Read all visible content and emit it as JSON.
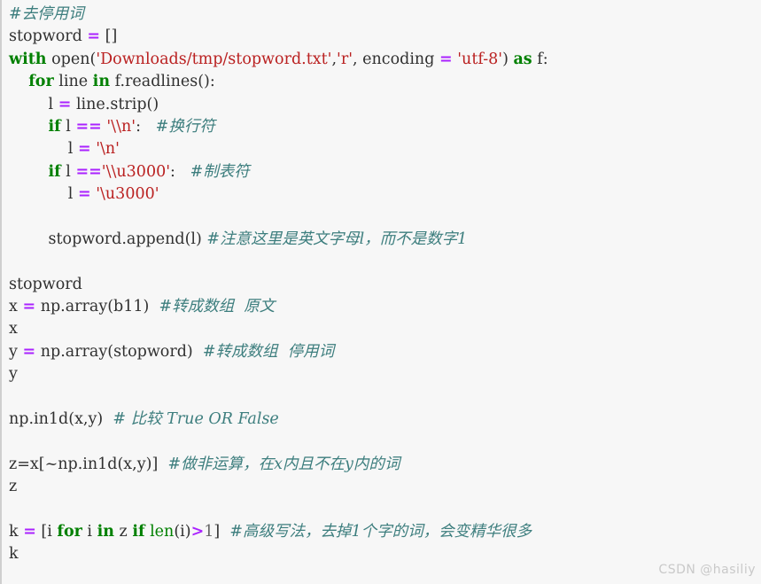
{
  "cell": {
    "type": "jupyter-code-cell",
    "language": "python",
    "background_color": "#f7f7f7",
    "left_border_color": "#cfcfcf",
    "syntax_colors": {
      "keyword": "#008000",
      "builtin": "#008000",
      "string": "#BA2121",
      "operator": "#AA22FF",
      "comment": "#3D7E7E",
      "plain": "#303030"
    }
  },
  "lines": [
    {
      "i": 0,
      "text": "#去停用词"
    },
    {
      "i": 1,
      "text": "stopword = []"
    },
    {
      "i": 2,
      "text": "with open('Downloads/tmp/stopword.txt','r', encoding = 'utf-8') as f:"
    },
    {
      "i": 3,
      "text": "    for line in f.readlines():"
    },
    {
      "i": 4,
      "text": "        l = line.strip()"
    },
    {
      "i": 5,
      "text": "        if l == '\\\\n':   #换行符"
    },
    {
      "i": 6,
      "text": "            l = '\\n'"
    },
    {
      "i": 7,
      "text": "        if l =='\\\\u3000':   #制表符"
    },
    {
      "i": 8,
      "text": "            l = '\\u3000'"
    },
    {
      "i": 9,
      "text": ""
    },
    {
      "i": 10,
      "text": "        stopword.append(l) #注意这里是英文字母l,而不是数字1"
    },
    {
      "i": 11,
      "text": ""
    },
    {
      "i": 12,
      "text": "stopword"
    },
    {
      "i": 13,
      "text": "x = np.array(b11)  #转成数组  原文"
    },
    {
      "i": 14,
      "text": "x"
    },
    {
      "i": 15,
      "text": "y = np.array(stopword)  #转成数组  停用词"
    },
    {
      "i": 16,
      "text": "y"
    },
    {
      "i": 17,
      "text": ""
    },
    {
      "i": 18,
      "text": "np.in1d(x,y)  # 比较 True OR False"
    },
    {
      "i": 19,
      "text": ""
    },
    {
      "i": 20,
      "text": "z=x[~np.in1d(x,y)]  #做非运算，在x内且不在y内的词"
    },
    {
      "i": 21,
      "text": "z"
    },
    {
      "i": 22,
      "text": ""
    },
    {
      "i": 23,
      "text": "k = [i for i in z if len(i)>1]  #高级写法，去掉1个字的词，会变精华很多"
    },
    {
      "i": 24,
      "text": "k"
    }
  ],
  "tokens": {
    "comment_remove_stopwords": "#去停用词",
    "var_stopword": "stopword",
    "op_assign": "=",
    "empty_list": "[]",
    "kw_with": "with",
    "fn_open": "open",
    "str_path": "'Downloads/tmp/stopword.txt'",
    "str_mode": "'r'",
    "arg_encoding": "encoding",
    "str_utf8": "'utf-8'",
    "kw_as": "as",
    "var_f": "f",
    "kw_for": "for",
    "var_line": "line",
    "kw_in": "in",
    "fn_readlines": "f.readlines()",
    "var_l": "l",
    "fn_strip": "line.strip()",
    "kw_if": "if",
    "op_eq": "==",
    "str_newline_escaped": "'\\\\n'",
    "comment_newline": "#换行符",
    "str_newline": "'\\n'",
    "str_u3000_escaped": "'\\\\u3000'",
    "comment_tab": "#制表符",
    "str_u3000": "'\\u3000'",
    "fn_append": "stopword.append(l)",
    "comment_letter_l": "#注意这里是英文字母l，而不是数字1",
    "var_x": "x",
    "fn_np_array_b11": "np.array(b11)",
    "comment_to_array_original": "#转成数组  原文",
    "var_y": "y",
    "fn_np_array_stopword": "np.array(stopword)",
    "comment_to_array_stopword": "#转成数组  停用词",
    "fn_np_in1d": "np.in1d(x,y)",
    "comment_compare": "# 比较 True OR False",
    "var_z": "z",
    "expr_not_in1d": "z=x[~np.in1d(x,y)]",
    "comment_not_op": "#做非运算，在x内且不在y内的词",
    "var_k": "k",
    "listcomp": "k = [i for i in z if len(i)>1]",
    "bi_len": "len",
    "num_1": "1",
    "op_gt": ">",
    "comment_advanced": "#高级写法，去掉1个字的词，会变精华很多"
  },
  "watermark": {
    "text": "CSDN @hasiliy"
  }
}
